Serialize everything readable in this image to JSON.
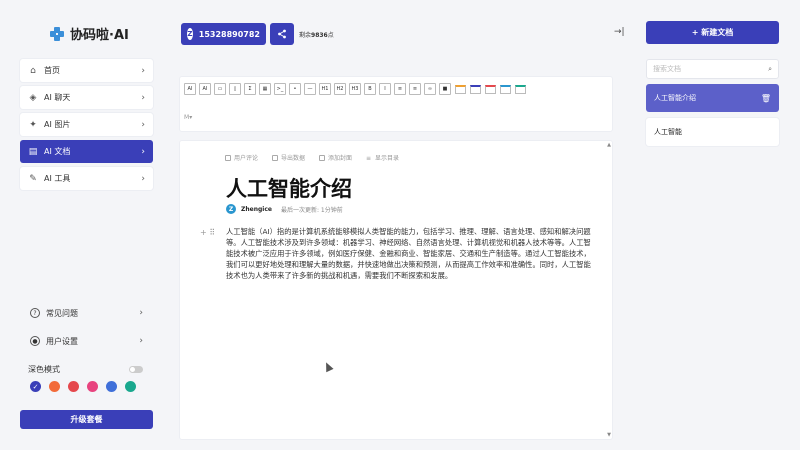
{
  "app": {
    "logo_text": "协码啦·AI"
  },
  "sidebar": {
    "items": [
      {
        "label": "首页",
        "icon": "home-icon",
        "glyph": "⌂"
      },
      {
        "label": "AI 聊天",
        "icon": "layers-icon",
        "glyph": "◈"
      },
      {
        "label": "AI 图片",
        "icon": "sparkle-icon",
        "glyph": "✦"
      },
      {
        "label": "AI 文档",
        "icon": "document-icon",
        "glyph": "▤",
        "active": true
      },
      {
        "label": "AI 工具",
        "icon": "wrench-icon",
        "glyph": "✎"
      }
    ],
    "bottom": {
      "faq_label": "常见问题",
      "settings_label": "用户设置",
      "dark_mode_label": "深色模式",
      "theme_colors": [
        "#3a3fb8",
        "#f26b3a",
        "#e5484d",
        "#e8437f",
        "#3f6fd9",
        "#1aa88e"
      ],
      "upgrade_label": "升级套餐"
    }
  },
  "topbar": {
    "user_avatar": "Z",
    "user_phone": "15328890782",
    "remaining_prefix": "剩余",
    "remaining_points": "9836",
    "remaining_suffix": "点"
  },
  "toolbar": {
    "buttons": [
      "AI",
      "AI",
      "▭",
      "▯",
      "Σ",
      "▦",
      ">_",
      "•",
      "—",
      "H1",
      "H2",
      "H3",
      "B",
      "I",
      "≡",
      "≡",
      "∞",
      "■",
      "▬",
      "▬",
      "▬",
      "▬",
      "▬"
    ],
    "mode": "M"
  },
  "editor": {
    "actions": [
      "用户评论",
      "导出数据",
      "添加封面",
      "显示目录"
    ],
    "title": "人工智能介绍",
    "author_avatar": "Z",
    "author_name": "Zhengice",
    "updated": "最后一次更新: 1分钟前",
    "body": "人工智能（AI）指的是计算机系统能够模拟人类智能的能力，包括学习、推理、理解、语言处理、感知和解决问题等。人工智能技术涉及到许多领域：机器学习、神经网络、自然语言处理、计算机视觉和机器人技术等等。人工智能技术被广泛应用于许多领域，例如医疗保健、金融和商业、智能家居、交通和生产制造等。通过人工智能技术，我们可以更好地处理和理解大量的数据，并快速地做出决策和预测，从而提高工作效率和准确性。同时，人工智能技术也为人类带来了许多新的挑战和机遇，需要我们不断探索和发展。"
  },
  "right_panel": {
    "new_doc_label": "+ 新建文档",
    "search_placeholder": "搜索文档",
    "docs": [
      {
        "label": "人工智能介绍",
        "active": true
      },
      {
        "label": "人工智能"
      }
    ]
  }
}
